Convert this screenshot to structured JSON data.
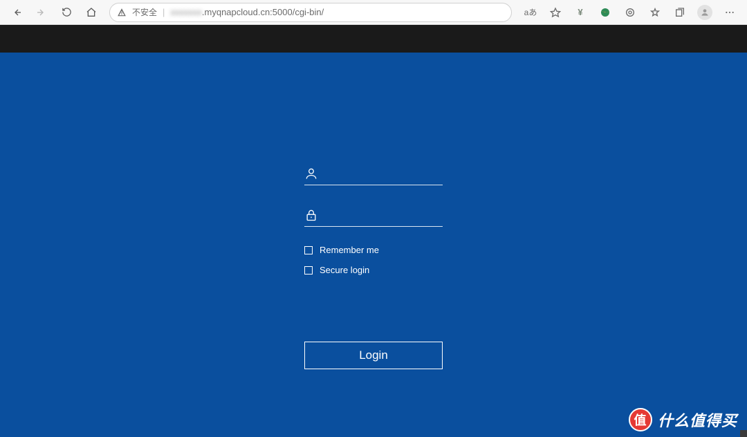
{
  "browser": {
    "insecure_label": "不安全",
    "reading_mode_label": "aあ",
    "url_blurred_prefix": "xxxxxxx",
    "url_visible": ".myqnapcloud.cn:5000/cgi-bin/"
  },
  "login": {
    "username_value": "",
    "password_value": "",
    "remember_label": "Remember me",
    "secure_label": "Secure login",
    "login_button_label": "Login"
  },
  "watermark": {
    "badge_char": "值",
    "text": "什么值得买"
  }
}
